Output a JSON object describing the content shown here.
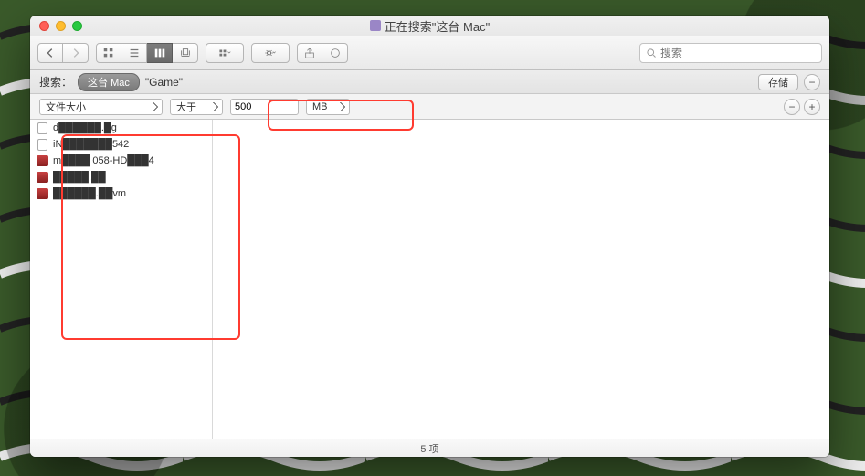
{
  "window": {
    "title": "正在搜索\"这台 Mac\""
  },
  "search": {
    "placeholder": "搜索"
  },
  "scope": {
    "label": "搜索：",
    "this_mac": "这台 Mac",
    "game": "\"Game\"",
    "save": "存储"
  },
  "criteria": {
    "attribute": "文件大小",
    "comparator": "大于",
    "value": "500",
    "unit": "MB"
  },
  "results": [
    {
      "icon": "doc",
      "name": "d██████.█g"
    },
    {
      "icon": "doc",
      "name": "iN███████542"
    },
    {
      "icon": "pkg",
      "name": "m████ 058-HD███4"
    },
    {
      "icon": "pkg",
      "name": "█████.██"
    },
    {
      "icon": "pkg",
      "name": "██████.██vm"
    }
  ],
  "status": {
    "text": "5 项"
  }
}
